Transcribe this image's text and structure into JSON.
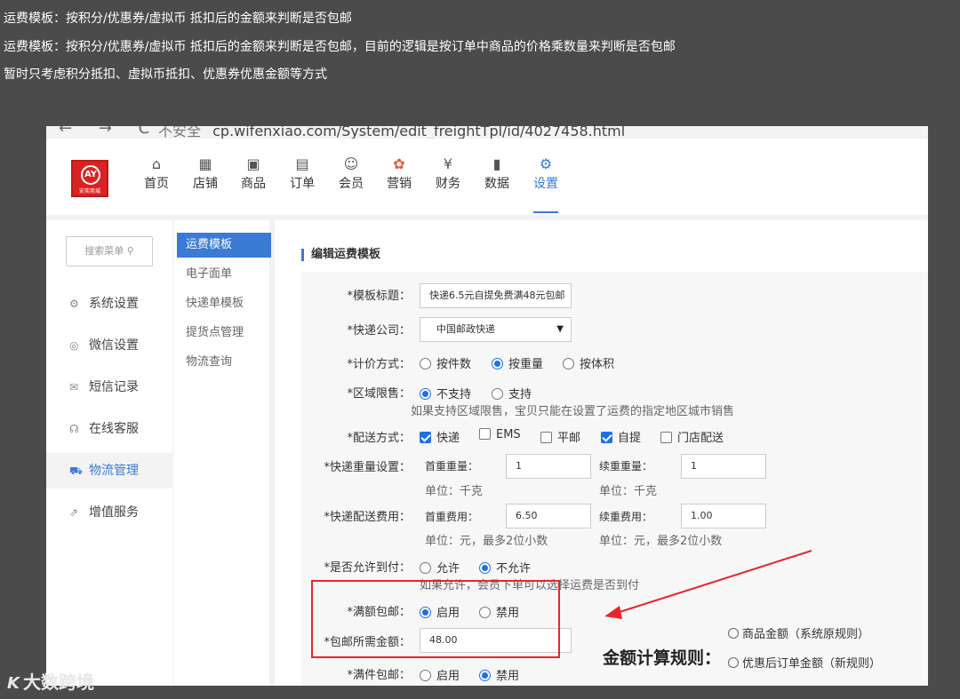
{
  "notes": {
    "line1": "运费模板：按积分/优惠券/虚拟币 抵扣后的金额来判断是否包邮",
    "line2": "运费模板：按积分/优惠券/虚拟币 抵扣后的金额来判断是否包邮，目前的逻辑是按订单中商品的价格乘数量来判断是否包邮",
    "line3": "暂时只考虑积分抵扣、虚拟币抵扣、优惠券优惠金额等方式"
  },
  "browser": {
    "nav_buttons": "← → C",
    "security": "不安全",
    "url": "cp.wifenxiao.com/System/edit_freightTpl/id/4027458.html"
  },
  "logo": {
    "mark": "AY",
    "text": "安奕商城"
  },
  "topnav": [
    {
      "label": "首页",
      "icon": "home-icon",
      "glyph": "⌂"
    },
    {
      "label": "店铺",
      "icon": "shop-icon",
      "glyph": "▦"
    },
    {
      "label": "商品",
      "icon": "goods-icon",
      "glyph": "▣"
    },
    {
      "label": "订单",
      "icon": "order-icon",
      "glyph": "▤"
    },
    {
      "label": "会员",
      "icon": "member-icon",
      "glyph": "☺"
    },
    {
      "label": "营销",
      "icon": "marketing-icon",
      "glyph": "✿"
    },
    {
      "label": "财务",
      "icon": "finance-icon",
      "glyph": "¥"
    },
    {
      "label": "数据",
      "icon": "data-icon",
      "glyph": "▮"
    },
    {
      "label": "设置",
      "icon": "settings-icon",
      "glyph": "⚙"
    }
  ],
  "sidebar": {
    "search_placeholder": "搜索菜单 ⚲",
    "items": [
      {
        "label": "系统设置",
        "icon": "gear-icon",
        "glyph": "⚙"
      },
      {
        "label": "微信设置",
        "icon": "wechat-icon",
        "glyph": "◎"
      },
      {
        "label": "短信记录",
        "icon": "mail-icon",
        "glyph": "✉"
      },
      {
        "label": "在线客服",
        "icon": "headset-icon",
        "glyph": "☊"
      },
      {
        "label": "物流管理",
        "icon": "truck-icon",
        "glyph": "⛟"
      },
      {
        "label": "增值服务",
        "icon": "chart-icon",
        "glyph": "⇗"
      }
    ]
  },
  "subnav": [
    "运费模板",
    "电子面单",
    "快递单模板",
    "提货点管理",
    "物流查询"
  ],
  "form": {
    "section_title": "编辑运费模板",
    "template_title": {
      "label": "*模板标题：",
      "value": "快递6.5元自提免费满48元包邮"
    },
    "courier": {
      "label": "*快递公司：",
      "value": "中国邮政快递"
    },
    "pricing": {
      "label": "*计价方式：",
      "options": [
        "按件数",
        "按重量",
        "按体积"
      ],
      "selected": 1
    },
    "region": {
      "label": "*区域限售：",
      "options": [
        "不支持",
        "支持"
      ],
      "selected": 0,
      "hint": "如果支持区域限售，宝贝只能在设置了运费的指定地区城市销售"
    },
    "delivery": {
      "label": "*配送方式：",
      "options": [
        {
          "label": "快递",
          "checked": true
        },
        {
          "label": "EMS",
          "checked": false
        },
        {
          "label": "平邮",
          "checked": false
        },
        {
          "label": "自提",
          "checked": true
        },
        {
          "label": "门店配送",
          "checked": false
        }
      ]
    },
    "weight": {
      "label": "*快递重量设置：",
      "first_label": "首重重量：",
      "first_value": "1",
      "first_unit": "单位：千克",
      "next_label": "续重重量：",
      "next_value": "1",
      "next_unit": "单位：千克"
    },
    "fee": {
      "label": "*快递配送费用：",
      "first_label": "首重费用：",
      "first_value": "6.50",
      "first_unit": "单位：元，最多2位小数",
      "next_label": "续重费用：",
      "next_value": "1.00",
      "next_unit": "单位：元，最多2位小数"
    },
    "cod": {
      "label": "*是否允许到付：",
      "options": [
        "允许",
        "不允许"
      ],
      "selected": 1,
      "hint": "如果允许，会员下单可以选择运费是否到付"
    },
    "free_amount": {
      "label": "*满额包邮：",
      "options": [
        "启用",
        "禁用"
      ],
      "selected": 0
    },
    "free_amount_value": {
      "label": "*包邮所需金额：",
      "value": "48.00"
    },
    "free_count": {
      "label": "*满件包邮：",
      "options": [
        "启用",
        "禁用"
      ],
      "selected": 1
    }
  },
  "annotation": {
    "title": "金额计算规则：",
    "option1": "商品金额（系统原规则）",
    "option2": "优惠后订单金额（新规则）",
    "arrow_color": "#e8262a"
  },
  "watermark": {
    "logo": "K",
    "text": "大数跨境"
  },
  "colors": {
    "accent": "#3a7bd5",
    "radio_blue": "#1e6fe8",
    "annotation_red": "#e8262a"
  }
}
